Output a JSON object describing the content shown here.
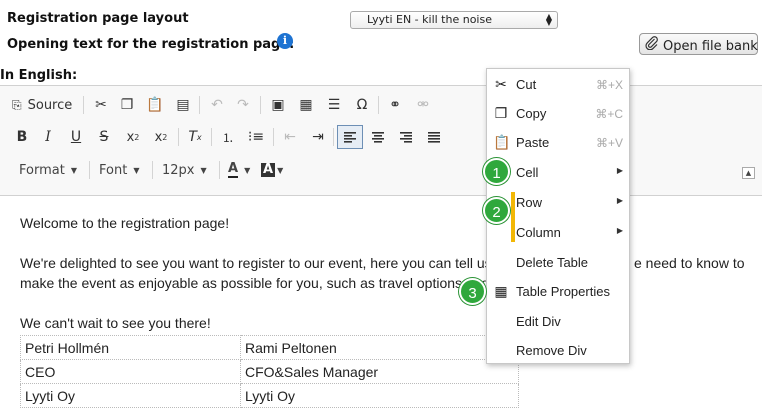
{
  "header": {
    "layout_label": "Registration page layout",
    "layout_select_value": "Lyyti EN - kill the noise",
    "opening_label": "Opening text for the registration page:",
    "info_icon": "i",
    "file_bank_label": "Open file bank",
    "language_label": "In English:"
  },
  "toolbar": {
    "source_label": "Source",
    "format_label": "Format",
    "font_label": "Font",
    "size_label": "12px"
  },
  "content": {
    "line1": "Welcome to the registration page!",
    "line2a": "We're delighted to see you want to register to our event, here you can tell us all a",
    "line2b": "e need to know to",
    "line3": "make the event as enjoyable as possible for you, such as travel options and di",
    "line4": "We can't wait to see you there!",
    "table": [
      [
        "Petri Hollmén",
        "Rami Peltonen"
      ],
      [
        "CEO",
        "CFO&Sales Manager"
      ],
      [
        "Lyyti Oy",
        "Lyyti Oy"
      ]
    ]
  },
  "context_menu": {
    "cut": {
      "label": "Cut",
      "shortcut": "⌘+X"
    },
    "copy": {
      "label": "Copy",
      "shortcut": "⌘+C"
    },
    "paste": {
      "label": "Paste",
      "shortcut": "⌘+V"
    },
    "cell": {
      "label": "Cell"
    },
    "row": {
      "label": "Row"
    },
    "column": {
      "label": "Column"
    },
    "delete_table": {
      "label": "Delete Table"
    },
    "table_properties": {
      "label": "Table Properties"
    },
    "edit_div": {
      "label": "Edit Div"
    },
    "remove_div": {
      "label": "Remove Div"
    }
  },
  "annotations": {
    "badge1": "1",
    "badge2": "2",
    "badge3": "3"
  },
  "colors": {
    "badge_green": "#2fa83c",
    "highlight_yellow": "#f2b705",
    "info_blue": "#1e73d2"
  }
}
